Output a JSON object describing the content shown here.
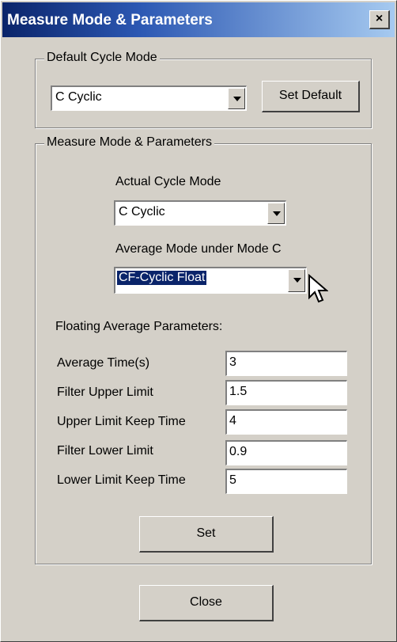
{
  "window": {
    "title": "Measure Mode & Parameters",
    "close_glyph": "×"
  },
  "default_cycle": {
    "group_label": "Default Cycle Mode",
    "mode_value": "C  Cyclic",
    "set_default_label": "Set Default"
  },
  "measure": {
    "group_label": "Measure Mode & Parameters",
    "actual_cycle_label": "Actual Cycle Mode",
    "actual_cycle_value": "C  Cyclic",
    "average_mode_label": "Average Mode under Mode C",
    "average_mode_value": "CF-Cyclic Float",
    "floating_params_label": "Floating Average Parameters:",
    "params": [
      {
        "label": "Average Time(s)",
        "value": "3"
      },
      {
        "label": "Filter Upper Limit",
        "value": "1.5"
      },
      {
        "label": "Upper Limit Keep Time",
        "value": "4"
      },
      {
        "label": "Filter Lower Limit",
        "value": "0.9"
      },
      {
        "label": "Lower Limit Keep Time",
        "value": "5"
      }
    ],
    "set_label": "Set"
  },
  "close_label": "Close",
  "icons": {
    "close": "close-icon",
    "dropdown": "chevron-down-icon",
    "cursor": "mouse-pointer-icon"
  },
  "colors": {
    "dialog_bg": "#d4d0c8",
    "title_start": "#0a246a",
    "title_end": "#a6caf0",
    "selection": "#0a246a"
  }
}
